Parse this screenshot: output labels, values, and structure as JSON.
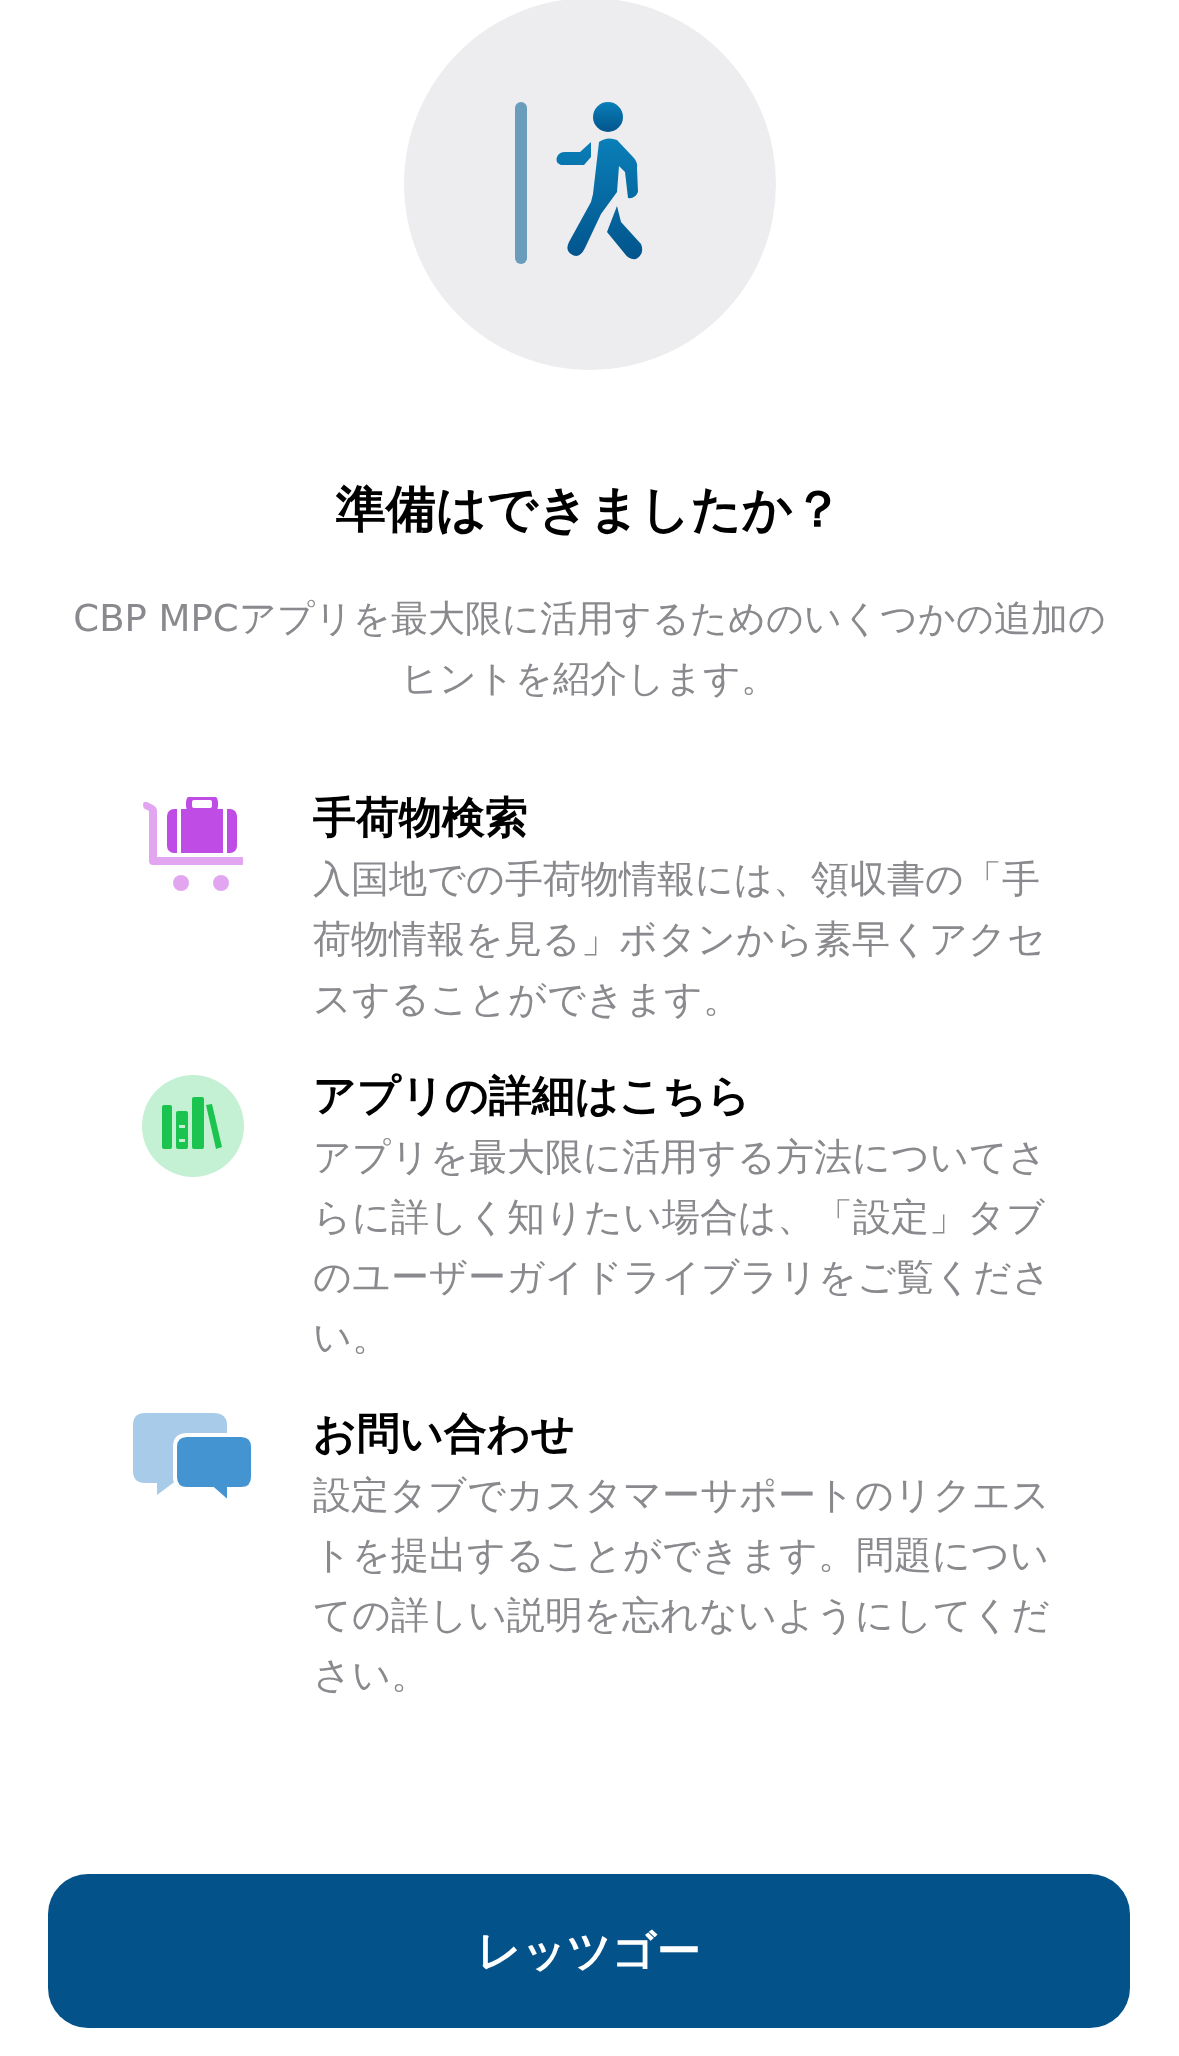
{
  "title": "準備はできましたか？",
  "subtitle": "CBP MPCアプリを最大限に活用するためのいくつかの追加のヒントを紹介します。",
  "tips": [
    {
      "kind": "luggage",
      "title": "手荷物検索",
      "body": "入国地での手荷物情報には、領収書の「手荷物情報を見る」ボタンから素早くアクセスすることができます。"
    },
    {
      "kind": "library",
      "title": "アプリの詳細はこちら",
      "body": "アプリを最大限に活用する方法についてさらに詳しく知りたい場合は、「設定」タブのユーザーガイドライブラリをご覧ください。"
    },
    {
      "kind": "chat",
      "title": "お問い合わせ",
      "body": "設定タブでカスタマーサポートのリクエストを提出することができます。問題についての詳しい説明を忘れないようにしてください。"
    }
  ],
  "button": {
    "label": "レッツゴー"
  }
}
